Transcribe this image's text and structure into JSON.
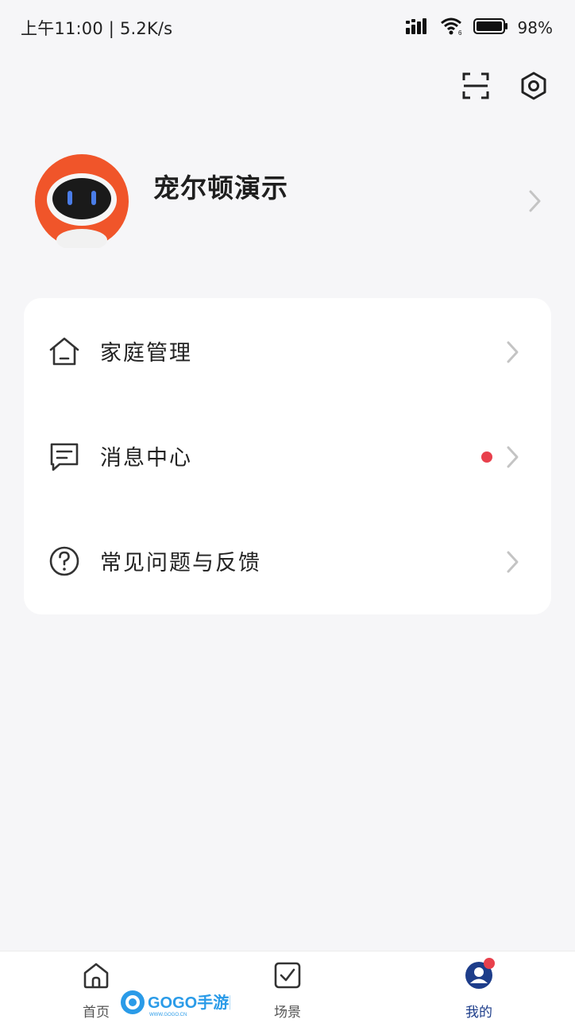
{
  "status_bar": {
    "time_speed": "上午11:00 | 5.2K/s",
    "battery_pct": "98%",
    "icons": [
      "signal-icon",
      "wifi-icon",
      "battery-icon"
    ]
  },
  "header": {
    "icons": [
      "scan-icon",
      "settings-icon"
    ]
  },
  "profile": {
    "name": "宠尔顿演示",
    "avatar_icon": "robot-avatar-icon"
  },
  "menu": {
    "items": [
      {
        "label": "家庭管理",
        "icon": "home-icon"
      },
      {
        "label": "消息中心",
        "icon": "message-icon",
        "has_unread_dot": true
      },
      {
        "label": "常见问题与反馈",
        "icon": "help-icon"
      }
    ]
  },
  "bottom_nav": {
    "items": [
      {
        "label": "首页",
        "icon": "home-icon"
      },
      {
        "label": "场景",
        "icon": "checkbox-icon"
      },
      {
        "label": "我的",
        "icon": "user-icon",
        "active": true
      }
    ]
  },
  "watermark": {
    "text": "GOGO手游网",
    "subtext": "WWW.GOGO.CN"
  },
  "colors": {
    "background": "#f6f6f8",
    "accent": "#1d3d8a",
    "badge": "#e8404c",
    "avatar_orange": "#f0552a"
  }
}
